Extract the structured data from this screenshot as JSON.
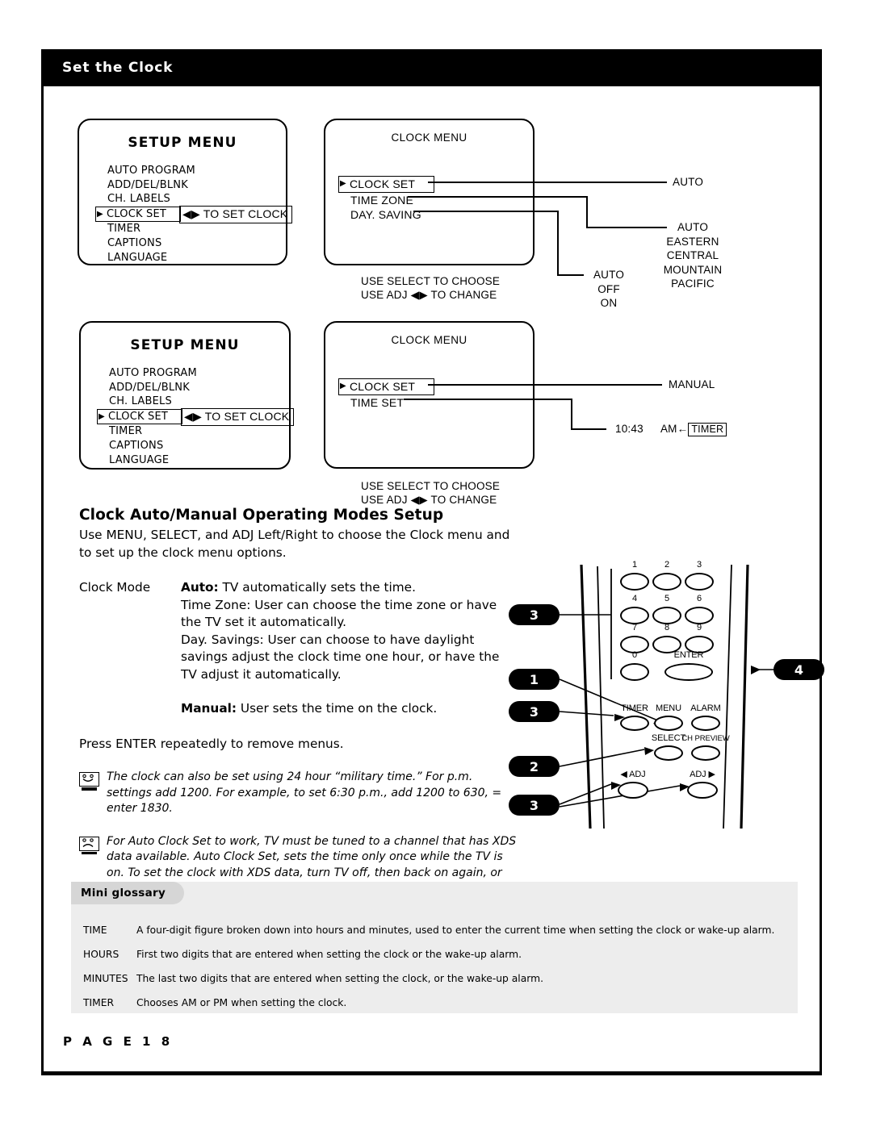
{
  "header": {
    "title": "Set the Clock"
  },
  "osd": {
    "setup_menu": {
      "title": "SETUP MENU",
      "items": [
        {
          "label": "AUTO PROGRAM",
          "selected": false
        },
        {
          "label": "ADD/DEL/BLNK",
          "selected": false
        },
        {
          "label": "CH. LABELS",
          "selected": false
        },
        {
          "label": "CLOCK SET",
          "selected": true
        },
        {
          "label": "TIMER",
          "selected": false
        },
        {
          "label": "CAPTIONS",
          "selected": false
        },
        {
          "label": "LANGUAGE",
          "selected": false
        }
      ],
      "hint": "◀▶ TO SET CLOCK"
    },
    "clock_menu_auto": {
      "title": "CLOCK MENU",
      "items": [
        {
          "label": "CLOCK SET",
          "selected": true
        },
        {
          "label": "TIME ZONE",
          "selected": false
        },
        {
          "label": "DAY. SAVING",
          "selected": false
        }
      ],
      "footer_line1": "USE SELECT TO CHOOSE",
      "footer_line2": "USE ADJ ◀▶ TO CHANGE",
      "values": {
        "clock_set": "AUTO",
        "time_zone": [
          "AUTO",
          "EASTERN",
          "CENTRAL",
          "MOUNTAIN",
          "PACIFIC"
        ],
        "day_saving": [
          "AUTO",
          "OFF",
          "ON"
        ]
      }
    },
    "clock_menu_manual": {
      "title": "CLOCK MENU",
      "items": [
        {
          "label": "CLOCK SET",
          "selected": true
        },
        {
          "label": "TIME SET",
          "selected": false
        }
      ],
      "footer_line1": "USE SELECT TO CHOOSE",
      "footer_line2": "USE ADJ ◀▶ TO CHANGE",
      "values": {
        "clock_set": "MANUAL",
        "time_display": "10:43",
        "meridiem": "AM",
        "arrow": "←",
        "timer_tag": "TIMER"
      }
    }
  },
  "content": {
    "section_title": "Clock Auto/Manual Operating Modes Setup",
    "intro": "Use MENU, SELECT, and ADJ Left/Right to choose the Clock menu and to set up the clock menu options.",
    "clock_mode_label": "Clock Mode",
    "mode_auto_term": "Auto:",
    "mode_auto_text": " TV automatically sets the time.",
    "mode_timezone_text": "Time Zone: User can choose the time zone or have the TV set it automatically.",
    "mode_daysaving_text": "Day. Savings: User can choose to have daylight savings adjust the clock time one hour, or have the TV adjust it automatically.",
    "mode_manual_term": "Manual:",
    "mode_manual_text": " User sets the time on the clock.",
    "press_enter": "Press ENTER repeatedly to remove menus.",
    "note1": "The clock can also be set using 24 hour “military time.” For p.m. settings add 1200. For example, to set 6:30 p.m., add 1200 to 630, = enter 1830.",
    "note2": "For Auto Clock Set to work, TV must be tuned to a channel that has XDS data available. Auto Clock Set, sets the time only once while the TV is on. To set the clock with XDS data, turn TV off, then back on again, or set the clock time manually."
  },
  "remote": {
    "keys": [
      "1",
      "2",
      "3",
      "4",
      "5",
      "6",
      "7",
      "8",
      "9",
      "0"
    ],
    "enter": "ENTER",
    "timer": "TIMER",
    "menu": "MENU",
    "alarm": "ALARM",
    "select": "SELECT",
    "ch_preview": "CH PREVIEW",
    "adj_left": "◀ ADJ",
    "adj_right": "ADJ ▶",
    "callouts": {
      "keypad": "3",
      "menu_btn": "1",
      "timer_btn": "3",
      "select_btn": "2",
      "adj_btns": "3",
      "enter_btn": "4"
    }
  },
  "glossary": {
    "tab_label": "Mini glossary",
    "rows": [
      {
        "term": "TIME",
        "definition": "A four-digit figure broken down into hours and minutes, used to enter the current time when setting the clock or wake-up alarm."
      },
      {
        "term": "HOURS",
        "definition": "First two digits that are entered when setting the clock or the wake-up alarm."
      },
      {
        "term": "MINUTES",
        "definition": "The last two digits that are entered when setting the clock, or the wake-up alarm."
      },
      {
        "term": "TIMER",
        "definition": "Chooses AM or PM when setting the clock."
      }
    ]
  },
  "footer": {
    "page": "P A G E   1 8"
  },
  "colors": {
    "ink": "#000000",
    "glossary_bg": "#ededed",
    "glossary_tab": "#d6d6d6"
  }
}
